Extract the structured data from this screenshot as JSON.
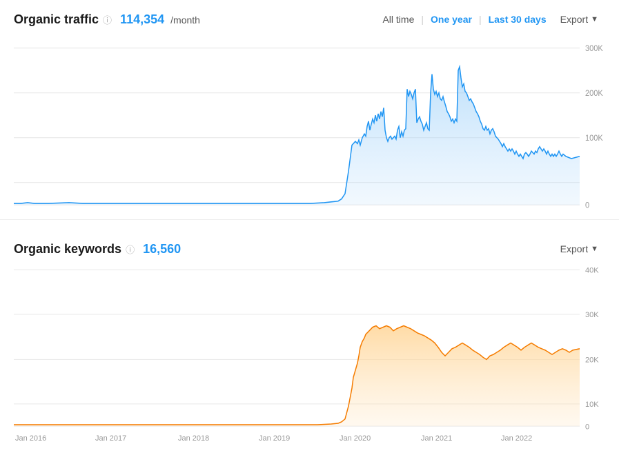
{
  "traffic": {
    "title": "Organic traffic",
    "metric": "114,354 /month",
    "metric_value": "114,354",
    "metric_suffix": "/month"
  },
  "keywords": {
    "title": "Organic keywords",
    "metric": "16,560",
    "metric_value": "16,560"
  },
  "filters": {
    "all_time": "All time",
    "one_year": "One year",
    "last_30_days": "Last 30 days",
    "export": "Export"
  },
  "traffic_chart": {
    "y_labels": [
      "300K",
      "200K",
      "100K",
      "0"
    ],
    "x_labels": [
      "Jan 2016",
      "Jan 2017",
      "Jan 2018",
      "Jan 2019",
      "Jan 2020",
      "Jan 2021",
      "Jan 2022"
    ]
  },
  "keywords_chart": {
    "y_labels": [
      "40K",
      "30K",
      "20K",
      "10K",
      "0"
    ],
    "x_labels": [
      "Jan 2016",
      "Jan 2017",
      "Jan 2018",
      "Jan 2019",
      "Jan 2020",
      "Jan 2021",
      "Jan 2022"
    ]
  }
}
